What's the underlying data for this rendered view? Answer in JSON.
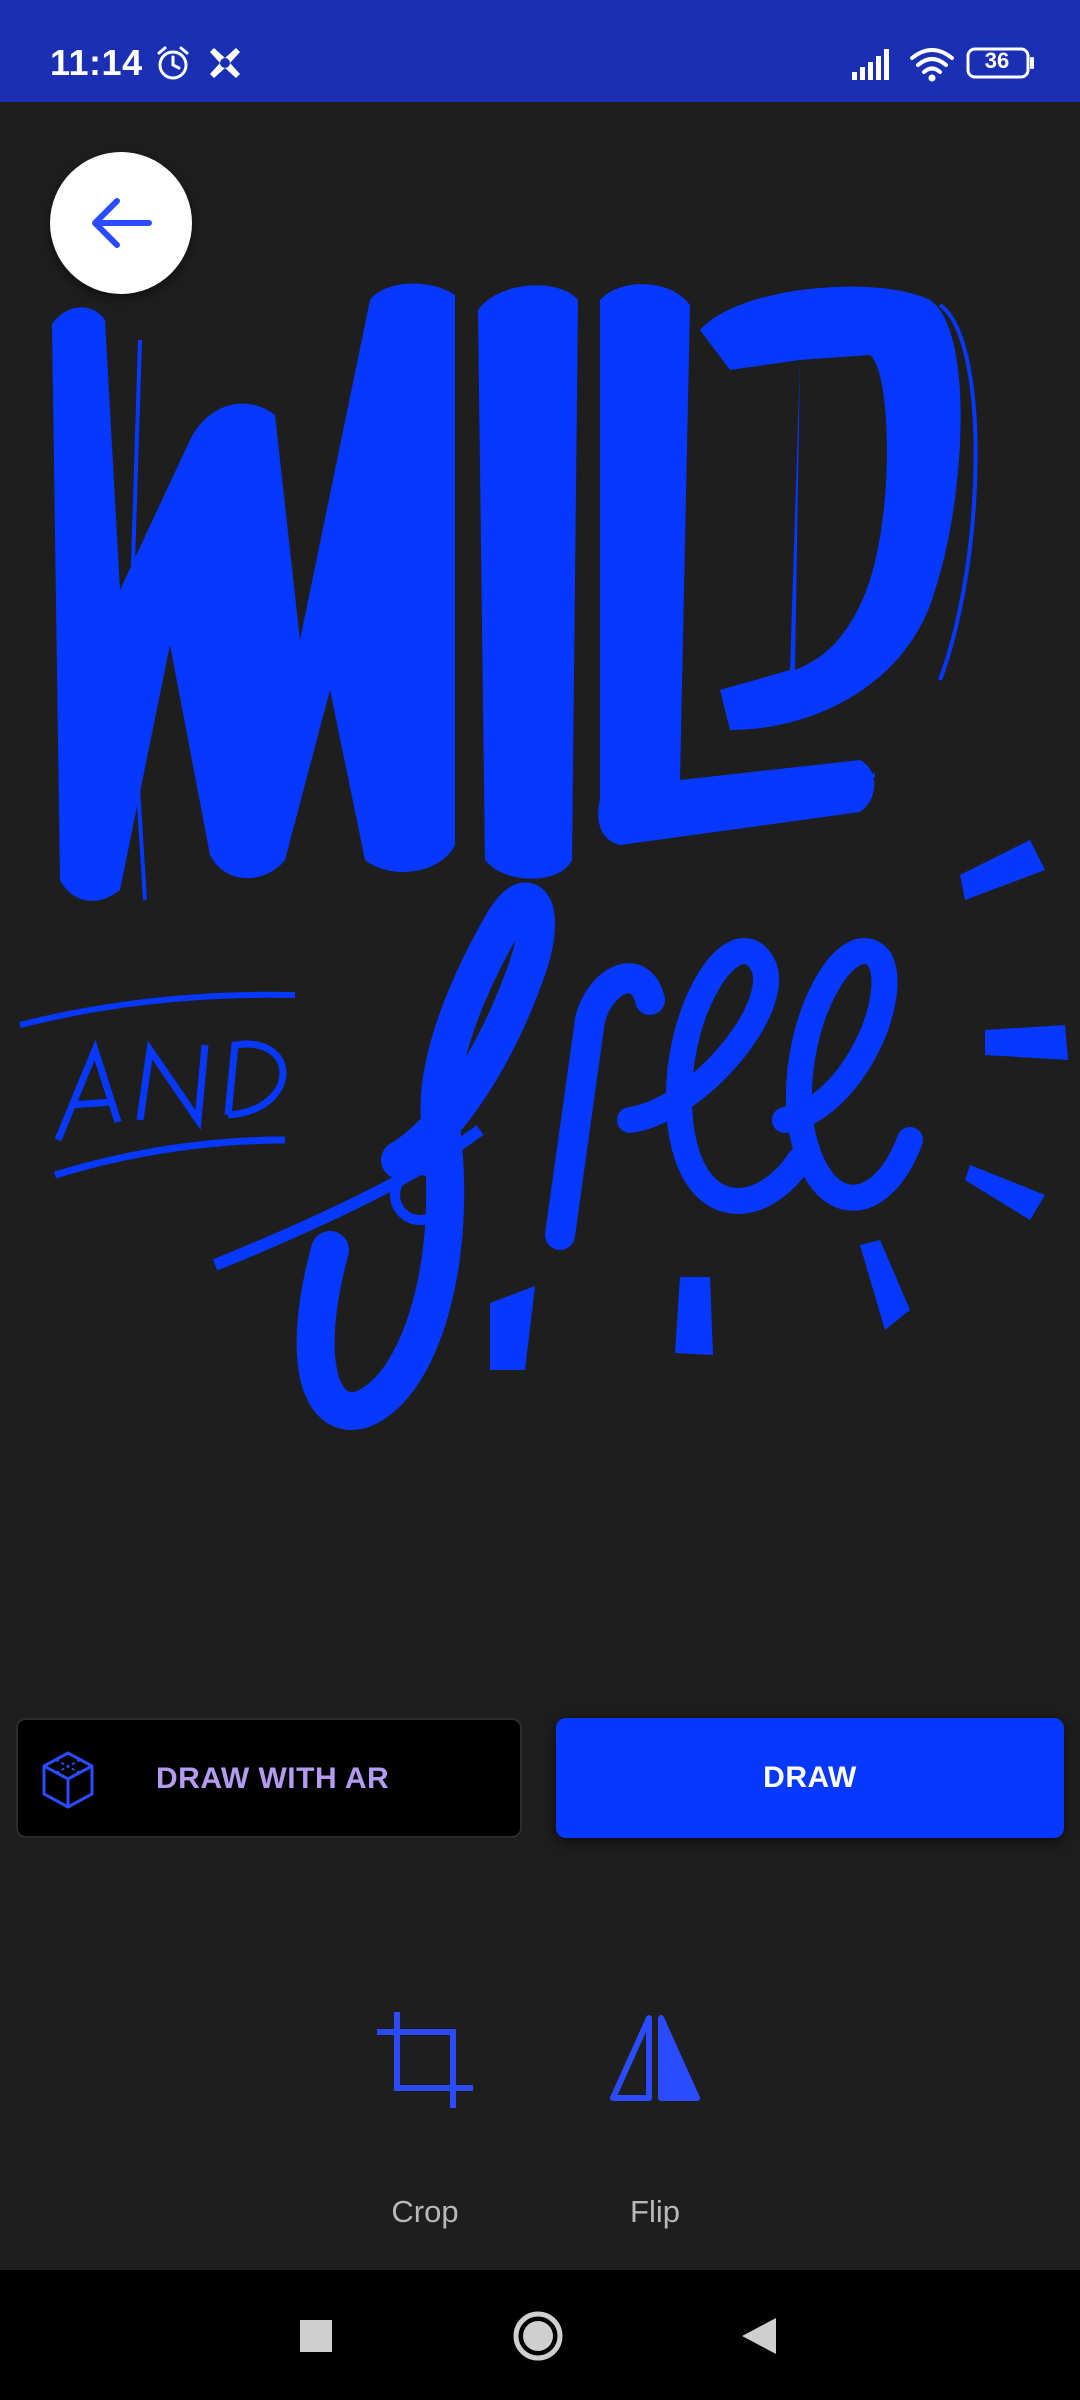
{
  "status_bar": {
    "time": "11:14",
    "battery": "36",
    "icons": [
      "alarm-icon",
      "app-notification-icon",
      "signal-icon",
      "wifi-icon",
      "battery-icon"
    ],
    "background": "#1a2fb3"
  },
  "toolbar": {
    "back_icon": "arrow-left-icon"
  },
  "artwork": {
    "lettering": [
      "WILD",
      "AND",
      "free"
    ],
    "color": "#0638ff"
  },
  "actions": {
    "ar_label": "DRAW WITH AR",
    "ar_icon": "ar-cube-icon",
    "draw_label": "DRAW",
    "accent": "#0638ff"
  },
  "tools": [
    {
      "label": "Crop",
      "icon": "crop-icon"
    },
    {
      "label": "Flip",
      "icon": "flip-icon"
    }
  ],
  "nav_bar": {
    "buttons": [
      "recents-square-icon",
      "home-circle-icon",
      "back-triangle-icon"
    ]
  }
}
